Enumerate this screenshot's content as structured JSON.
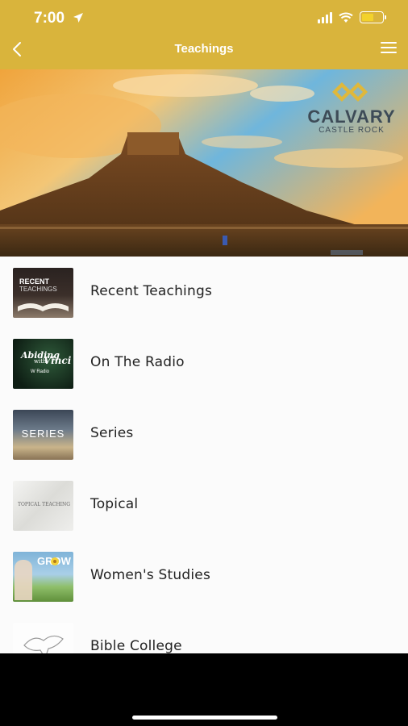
{
  "status_bar": {
    "time": "7:00",
    "icons": [
      "location-arrow-icon",
      "signal-icon",
      "wifi-icon",
      "battery-icon"
    ]
  },
  "nav": {
    "title": "Teachings",
    "back_icon": "chevron-left-icon",
    "menu_icon": "hamburger-menu-icon"
  },
  "banner": {
    "brand_name": "CALVARY",
    "brand_sub": "CASTLE ROCK"
  },
  "thumbnails": {
    "recent_line1": "RECENT",
    "recent_line2": "TEACHINGS",
    "radio_line1": "Abiding",
    "radio_line2": "with",
    "radio_line3": "Vinci",
    "radio_line4": "W Radio",
    "series": "SERIES",
    "topical": "TOPICAL TEACHING",
    "women": "GROW"
  },
  "items": [
    {
      "label": "Recent Teachings"
    },
    {
      "label": "On The Radio"
    },
    {
      "label": "Series"
    },
    {
      "label": "Topical"
    },
    {
      "label": "Women's Studies"
    },
    {
      "label": "Bible College"
    }
  ],
  "colors": {
    "header": "#d9b43c",
    "accent": "#e0b83a",
    "list_bg": "#fbfbfb"
  }
}
